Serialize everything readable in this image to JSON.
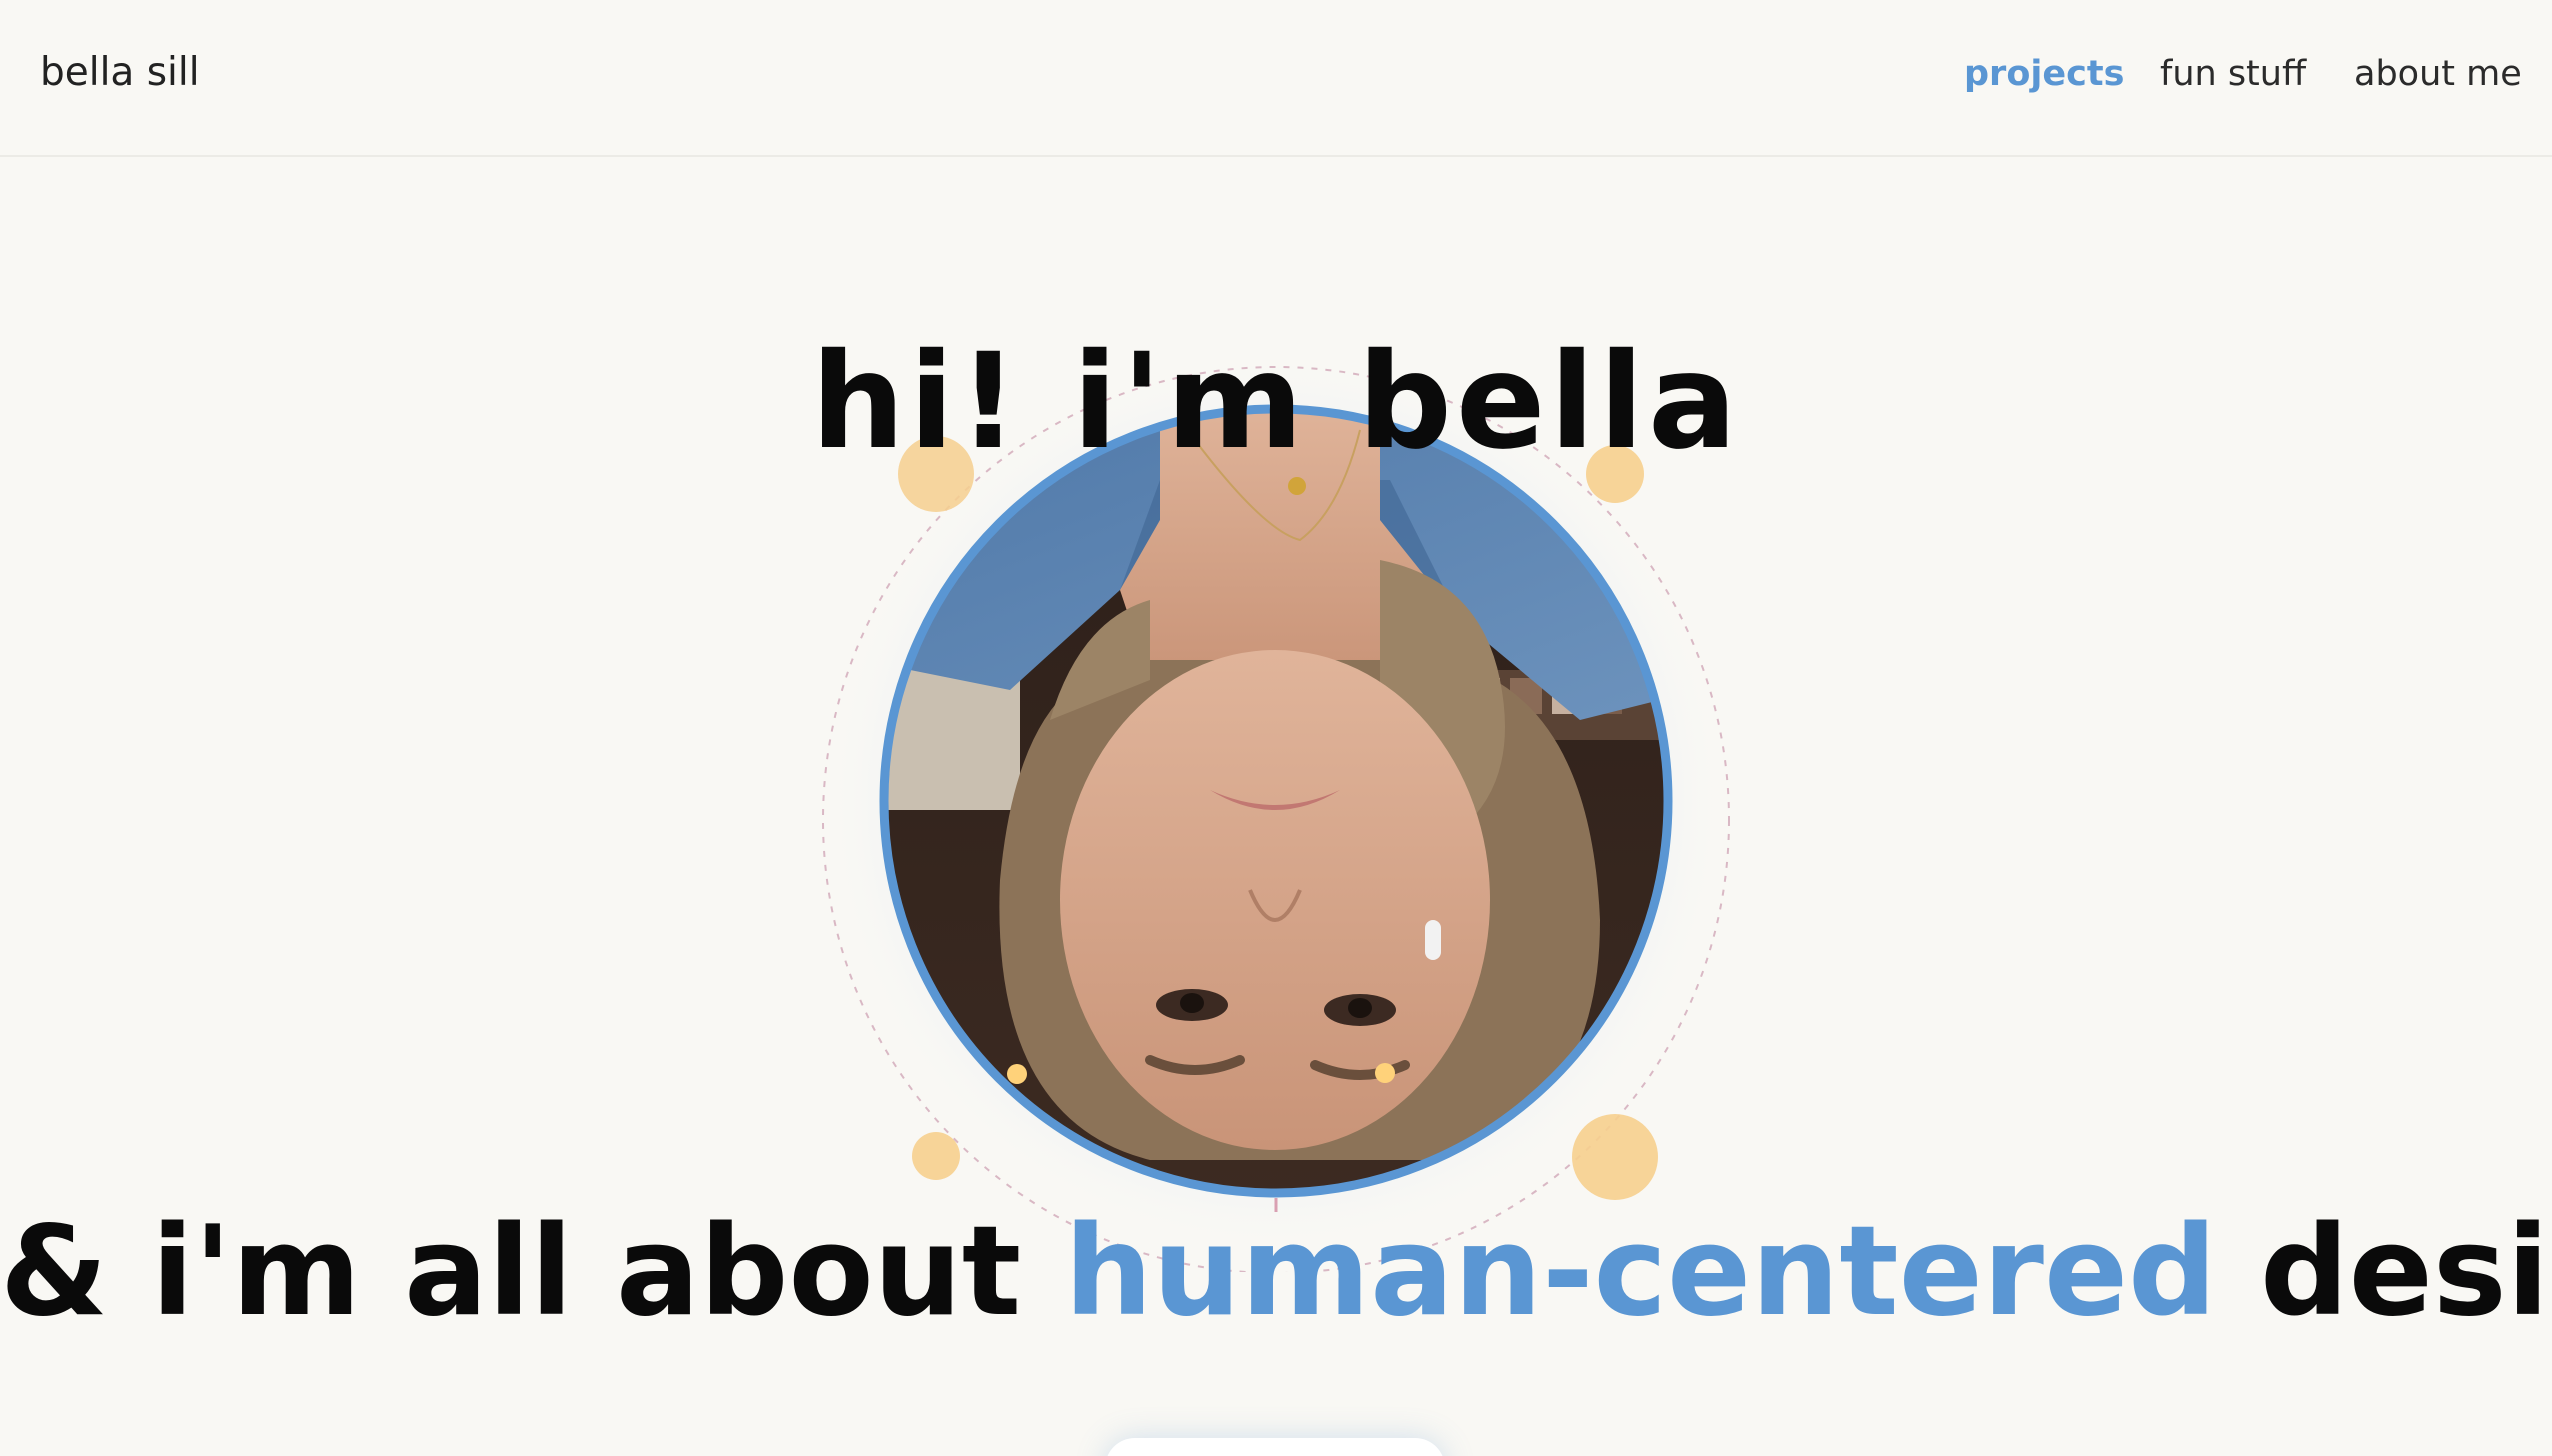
{
  "nav": {
    "brand": "bella sill",
    "links": [
      {
        "label": "projects",
        "active": true
      },
      {
        "label": "fun stuff",
        "active": false
      },
      {
        "label": "about me",
        "active": false
      }
    ]
  },
  "hero": {
    "title": "hi! i'm bella",
    "tagline_prefix": "& i'm all about ",
    "tagline_accent": "human-centered",
    "tagline_suffix": " design"
  },
  "colors": {
    "accent": "#5a96d3",
    "background": "#f9f8f4",
    "decor_dot": "#f6cf8e",
    "text": "#0a0a0a"
  }
}
